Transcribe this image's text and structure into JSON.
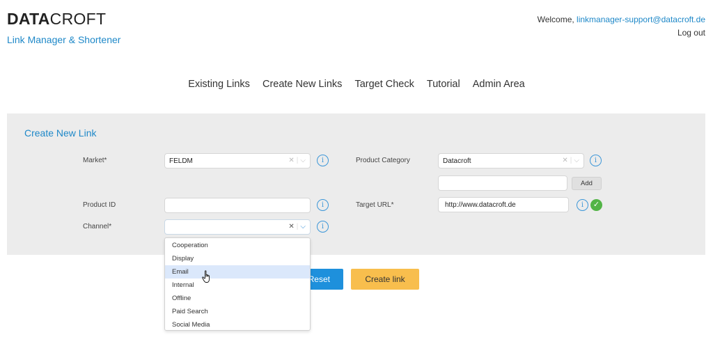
{
  "brand": {
    "bold": "DATA",
    "light": "CROFT",
    "subtitle": "Link Manager & Shortener"
  },
  "user": {
    "welcome": "Welcome, ",
    "email": "linkmanager-support@datacroft.de",
    "logout": "Log out"
  },
  "nav": [
    "Existing Links",
    "Create New Links",
    "Target Check",
    "Tutorial",
    "Admin Area"
  ],
  "form": {
    "title": "Create New Link",
    "market": {
      "label": "Market*",
      "value": "FELDM"
    },
    "product_category": {
      "label": "Product Category",
      "value": "Datacroft",
      "new_value": "",
      "add_label": "Add"
    },
    "product_id": {
      "label": "Product ID",
      "value": ""
    },
    "target_url": {
      "label": "Target URL*",
      "value": "http://www.datacroft.de",
      "status": "valid"
    },
    "channel": {
      "label": "Channel*",
      "value": "",
      "options": [
        "Cooperation",
        "Display",
        "Email",
        "Internal",
        "Offline",
        "Paid Search",
        "Social Media"
      ],
      "highlighted": "Email"
    },
    "reset_label": "Reset",
    "create_label": "Create link"
  },
  "icons": {
    "info": "info-icon",
    "clear": "clear-icon",
    "chevron": "chevron-down-icon",
    "check": "check-icon",
    "cursor": "hand-cursor-icon"
  },
  "colors": {
    "accent": "#1e88c8",
    "primary_button": "#1e90dc",
    "create_button": "#f8be4d",
    "success": "#52b446",
    "highlight": "#dbe8fb"
  }
}
